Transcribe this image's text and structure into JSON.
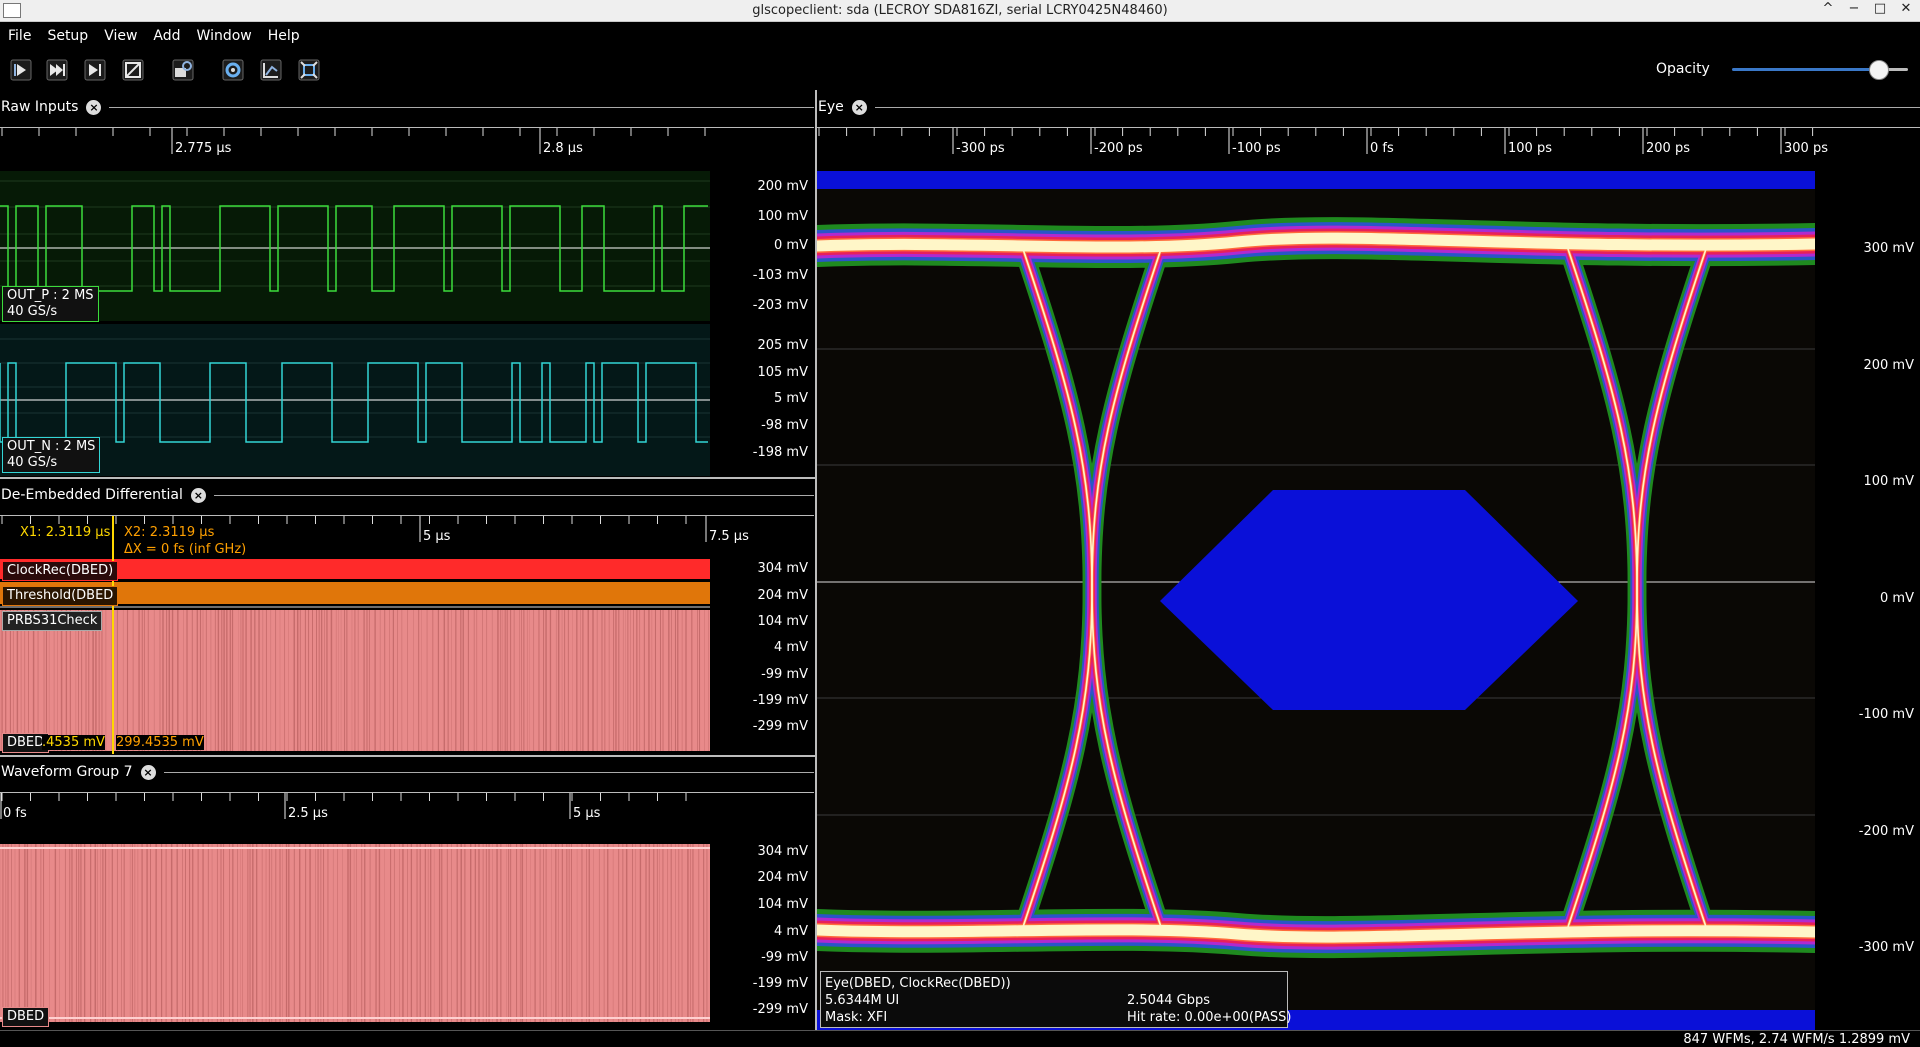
{
  "window": {
    "title": "glscopeclient: sda (LECROY SDA816ZI, serial LCRY0425N48460)",
    "controls": [
      "^",
      "−",
      "□",
      "✕"
    ]
  },
  "menu": [
    "File",
    "Setup",
    "View",
    "Add",
    "Window",
    "Help"
  ],
  "toolbar": {
    "buttons": [
      "start-icon",
      "single-trigger-icon",
      "force-trigger-icon",
      "stop-icon",
      "history-icon",
      "refresh-icon",
      "fullscreen-icon",
      "zoom-fit-icon"
    ],
    "opacity_label": "Opacity",
    "opacity_value": 0.88
  },
  "raw_inputs": {
    "title": "Raw Inputs",
    "ruler_labels": [
      "2.775 µs",
      "2.8 µs"
    ],
    "channels": [
      {
        "name": "OUT_P : 2 MS",
        "rate": "40 GS/s",
        "color": "#3cdc3c",
        "axis": [
          "200 mV",
          "100 mV",
          "0 mV",
          "-103 mV",
          "-203 mV"
        ]
      },
      {
        "name": "OUT_N : 2 MS",
        "rate": "40 GS/s",
        "color": "#33d6d6",
        "axis": [
          "205 mV",
          "105 mV",
          "5 mV",
          "-98 mV",
          "-198 mV"
        ]
      }
    ]
  },
  "deembedded": {
    "title": "De-Embedded Differential",
    "ruler_labels": [
      "5 µs",
      "7.5 µs"
    ],
    "cursor1": "X1: 2.3119 µs",
    "cursor2": "X2: 2.3119 µs",
    "delta": "ΔX = 0 fs (inf GHz)",
    "traces": [
      "ClockRec(DBED)",
      "Threshold(DBED",
      "PRBS31Check"
    ],
    "channel": "DBED",
    "cursor_value1": ".4535 mV",
    "cursor_value2": "299.4535 mV",
    "axis": [
      "304 mV",
      "204 mV",
      "104 mV",
      "4 mV",
      "-99 mV",
      "-199 mV",
      "-299 mV"
    ]
  },
  "group7": {
    "title": "Waveform Group 7",
    "ruler_labels": [
      "0 fs",
      "2.5 µs",
      "5 µs"
    ],
    "channel": "DBED",
    "axis": [
      "304 mV",
      "204 mV",
      "104 mV",
      "4 mV",
      "-99 mV",
      "-199 mV",
      "-299 mV"
    ]
  },
  "eye": {
    "title": "Eye",
    "ruler_labels": [
      "-300 ps",
      "-200 ps",
      "-100 ps",
      "0 fs",
      "100 ps",
      "200 ps",
      "300 ps"
    ],
    "axis": [
      "300 mV",
      "200 mV",
      "100 mV",
      "0 mV",
      "-100 mV",
      "-200 mV",
      "-300 mV"
    ],
    "info_title": "Eye(DBED, ClockRec(DBED))",
    "ui": "5.6344M UI",
    "rate": "2.5044 Gbps",
    "mask": "Mask: XFI",
    "hit_rate": "Hit rate: 0.00e+00(PASS)"
  },
  "status": "847 WFMs, 2.74 WFM/s    1.2899 mV",
  "colors": {
    "accent": "#3a78c8",
    "mask": "#0a10d8",
    "dbed_trace": "#e88a8a",
    "clockrec": "#ff2a2a",
    "threshold": "#e0760a",
    "cursor1": "#ffd800",
    "cursor2": "#ffa000"
  }
}
